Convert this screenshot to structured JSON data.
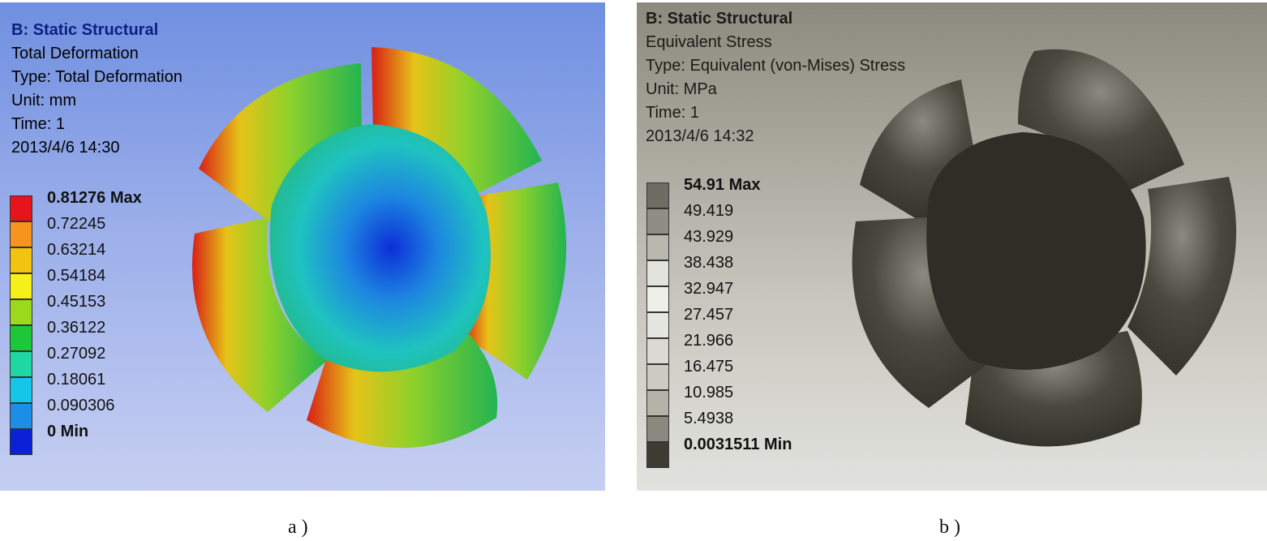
{
  "panel_a": {
    "analysis": "B: Static Structural",
    "result_name": "Total Deformation",
    "type": "Type: Total Deformation",
    "unit": "Unit: mm",
    "time": "Time: 1",
    "timestamp": "2013/4/6 14:30",
    "legend": [
      {
        "label": "0.81276 Max",
        "color": "#e8141c",
        "bold": true
      },
      {
        "label": "0.72245",
        "color": "#f7941e"
      },
      {
        "label": "0.63214",
        "color": "#f2c40f"
      },
      {
        "label": "0.54184",
        "color": "#f5f017"
      },
      {
        "label": "0.45153",
        "color": "#9ad91c"
      },
      {
        "label": "0.36122",
        "color": "#1ec73a"
      },
      {
        "label": "0.27092",
        "color": "#1fd7a3"
      },
      {
        "label": "0.18061",
        "color": "#14c6e8"
      },
      {
        "label": "0.090306",
        "color": "#1b8fe8"
      },
      {
        "label": "0 Min",
        "color": "#0a21d6",
        "bold": true
      }
    ],
    "caption": "a )"
  },
  "panel_b": {
    "analysis": "B: Static Structural",
    "result_name": "Equivalent Stress",
    "type": "Type: Equivalent (von-Mises) Stress",
    "unit": "Unit: MPa",
    "time": "Time: 1",
    "timestamp": "2013/4/6 14:32",
    "legend": [
      {
        "label": "54.91 Max",
        "color": "#6e6d63",
        "bold": true
      },
      {
        "label": "49.419",
        "color": "#8f8e84"
      },
      {
        "label": "43.929",
        "color": "#b9b8ae"
      },
      {
        "label": "38.438",
        "color": "#e3e3dd"
      },
      {
        "label": "32.947",
        "color": "#efefea"
      },
      {
        "label": "27.457",
        "color": "#e6e6e0"
      },
      {
        "label": "21.966",
        "color": "#dadad3"
      },
      {
        "label": "16.475",
        "color": "#cccbc3"
      },
      {
        "label": "10.985",
        "color": "#b4b3a9"
      },
      {
        "label": "5.4938",
        "color": "#8a897f"
      },
      {
        "label": "0.0031511 Min",
        "color": "#3d3c34",
        "bold": true
      }
    ],
    "caption": "b )"
  }
}
